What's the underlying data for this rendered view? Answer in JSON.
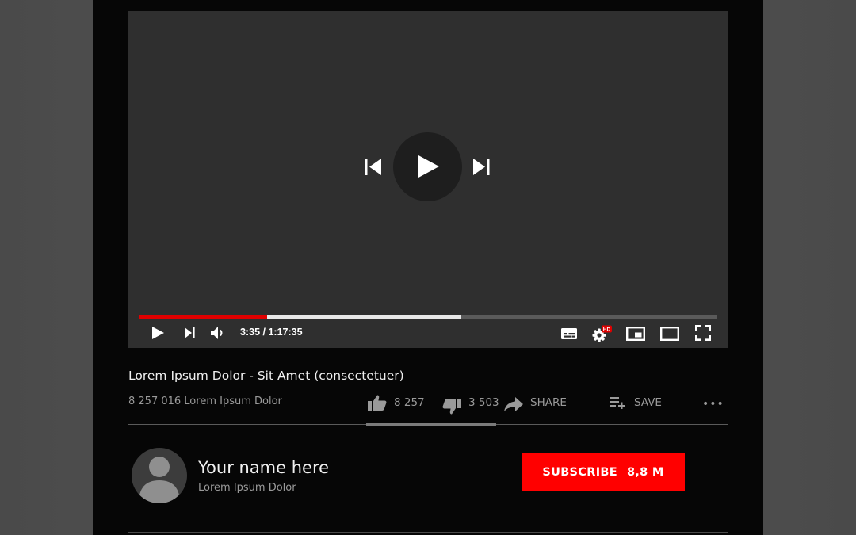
{
  "player": {
    "current_time": "3:35",
    "separator": " / ",
    "duration": "1:17:35",
    "progress_played": 0.222,
    "progress_buffered": 0.557,
    "hd_badge": "HD",
    "icons": [
      "skip-previous-icon",
      "play-icon",
      "skip-next-icon",
      "volume-icon",
      "subtitles-icon",
      "settings-icon",
      "miniplayer-icon",
      "theater-mode-icon",
      "fullscreen-icon"
    ]
  },
  "video": {
    "title": "Lorem Ipsum Dolor - Sit Amet (consectetuer)",
    "views": "8 257 016 Lorem Ipsum Dolor"
  },
  "actions": {
    "likes": "8 257",
    "dislikes": "3 503",
    "share_label": "SHARE",
    "save_label": "SAVE",
    "more_label": "•••"
  },
  "channel": {
    "name": "Your name here",
    "subtitle": "Lorem Ipsum Dolor",
    "subscribe_label": "SUBSCRIBE",
    "subscriber_count": "8,8 M"
  },
  "colors": {
    "accent": "#ff0000",
    "progress_played": "#e00000",
    "background": "#060606",
    "player": "#2f2f2f"
  }
}
